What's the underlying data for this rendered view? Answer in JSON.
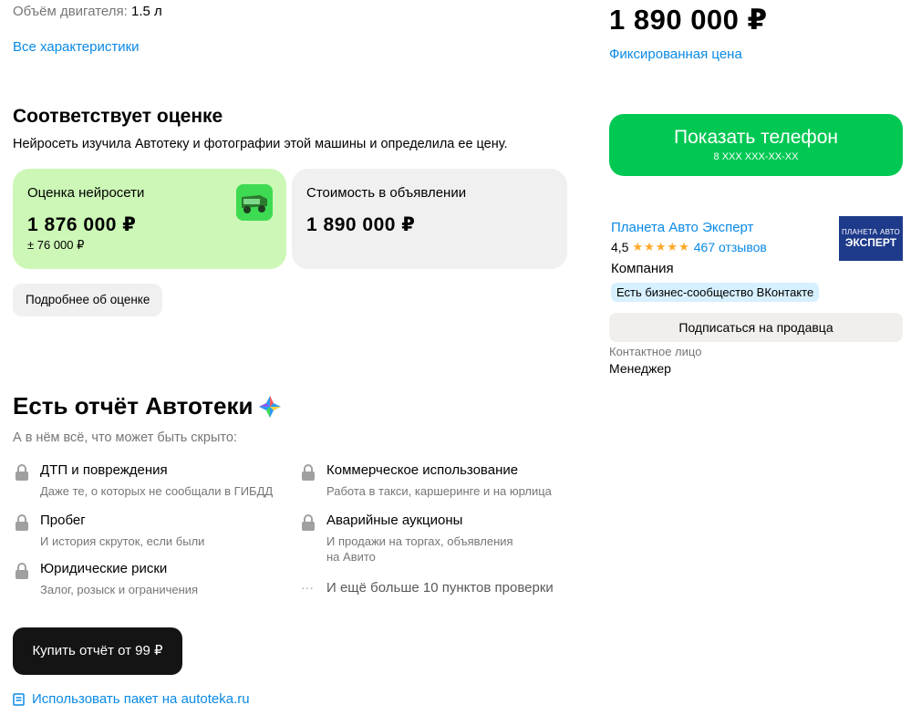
{
  "specs": {
    "engine_label": "Объём двигателя:",
    "engine_value": "1.5 л",
    "all_specs_link": "Все характеристики"
  },
  "estimate": {
    "title": "Соответствует оценке",
    "subtitle": "Нейросеть изучила Автотеку и фотографии этой машины и определила ее цену.",
    "ai_card": {
      "label": "Оценка нейросети",
      "price": "1 876 000 ₽",
      "range": "± 76 000 ₽"
    },
    "listing_card": {
      "label": "Стоимость в объявлении",
      "price": "1 890 000 ₽"
    },
    "more_button": "Подробнее об оценке"
  },
  "report": {
    "title": "Есть отчёт Автотеки",
    "subtitle": "А в нём всё, что может быть скрыто:",
    "features_left": [
      {
        "title": "ДТП и повреждения",
        "desc": "Даже те, о которых не сообщали в ГИБДД"
      },
      {
        "title": "Пробег",
        "desc": "И история скруток, если были"
      },
      {
        "title": "Юридические риски",
        "desc": "Залог, розыск и ограничения"
      }
    ],
    "features_right": [
      {
        "title": "Коммерческое использование",
        "desc": "Работа в такси, каршеринге и на юрлица"
      },
      {
        "title": "Аварийные аукционы",
        "desc_line1": "И продажи на торгах, объявления",
        "desc_line2": "на Авито"
      }
    ],
    "more_points": "И ещё больше 10 пунктов проверки",
    "buy_button": "Купить отчёт от 99 ₽",
    "package_link": "Использовать пакет на autoteka.ru"
  },
  "sidebar": {
    "price": "1 890 000 ₽",
    "price_type": "Фиксированная цена",
    "phone_button": "Показать телефон",
    "phone_mask": "8 XXX XXX-XX-XX",
    "seller_name": "Планета Авто Эксперт",
    "rating": "4,5",
    "stars": "★★★★★",
    "reviews": "467 отзывов",
    "seller_type": "Компания",
    "vk_badge": "Есть бизнес-сообщество ВКонтакте",
    "logo_line1": "ПЛАНЕТА АВТО",
    "logo_line2": "ЭКСПЕРТ",
    "subscribe_button": "Подписаться на продавца",
    "contact_label": "Контактное лицо",
    "contact_value": "Менеджер"
  },
  "colors": {
    "link": "#0a8ae6",
    "ai_card_bg": "#ccf7b6",
    "phone_button_bg": "#00c853",
    "buy_button_bg": "#141414",
    "star": "#ffa826"
  },
  "icons": {
    "lock": "lock-icon",
    "car": "car-icon",
    "autoteka": "autoteka-logo-icon",
    "document": "document-icon",
    "ellipsis": "ellipsis-icon"
  }
}
